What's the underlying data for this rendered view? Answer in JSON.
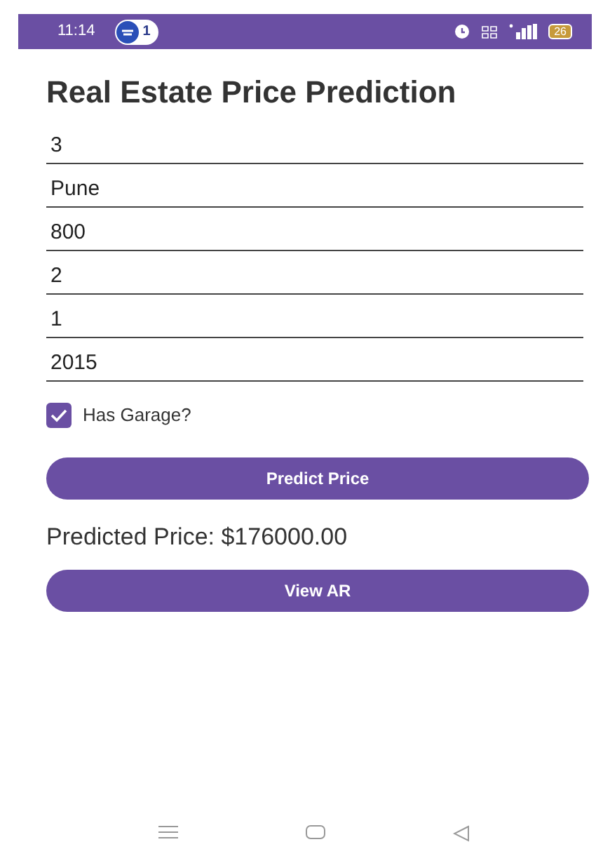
{
  "status_bar": {
    "time": "11:14",
    "notification_count": "1",
    "battery": "26"
  },
  "title": "Real Estate Price Prediction",
  "fields": [
    {
      "value": "3"
    },
    {
      "value": "Pune"
    },
    {
      "value": "800"
    },
    {
      "value": "2"
    },
    {
      "value": "1"
    },
    {
      "value": "2015"
    }
  ],
  "garage": {
    "label": "Has Garage?",
    "checked": true
  },
  "predict_button": "Predict Price",
  "result": "Predicted Price: $176000.00",
  "ar_button": "View AR"
}
